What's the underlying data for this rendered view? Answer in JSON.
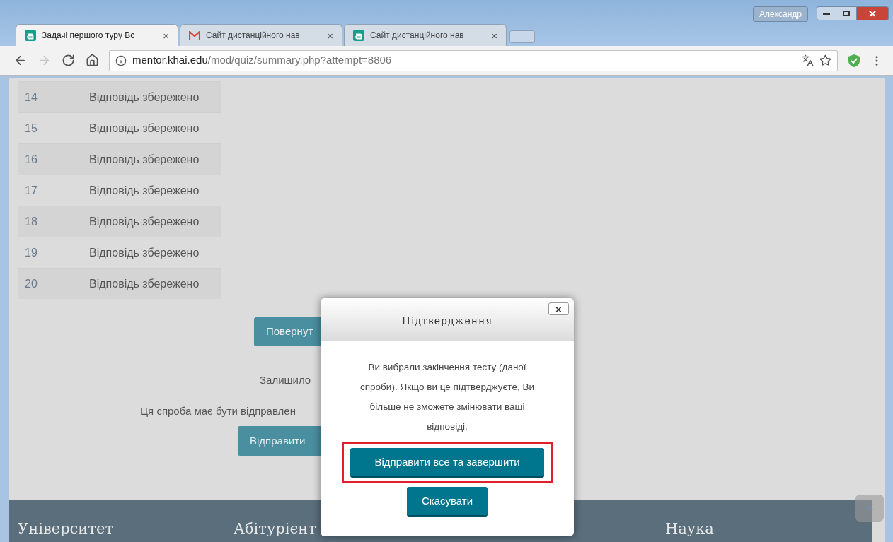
{
  "browser": {
    "profile": "Александр",
    "tabs": [
      {
        "title": "Задачі першого туру Вс",
        "kind": "moodle",
        "selected": true
      },
      {
        "title": "Сайт дистанційного нав",
        "kind": "gmail",
        "selected": false
      },
      {
        "title": "Сайт дистанційного нав",
        "kind": "moodle",
        "selected": false
      }
    ],
    "tab_close": "×",
    "nav_buttons": [
      {
        "kind": "back",
        "disabled": false
      },
      {
        "kind": "forward",
        "disabled": true
      },
      {
        "kind": "reload",
        "disabled": false
      },
      {
        "kind": "home",
        "disabled": false
      }
    ],
    "address": {
      "host": "mentor.khai.edu",
      "path": "/mod/quiz/summary.php?attempt=8806"
    }
  },
  "summary_rows": [
    {
      "number": "14",
      "status": "Відповідь збережено"
    },
    {
      "number": "15",
      "status": "Відповідь збережено"
    },
    {
      "number": "16",
      "status": "Відповідь збережено"
    },
    {
      "number": "17",
      "status": "Відповідь збережено"
    },
    {
      "number": "18",
      "status": "Відповідь збережено"
    },
    {
      "number": "19",
      "status": "Відповідь збережено"
    },
    {
      "number": "20",
      "status": "Відповідь збережено"
    }
  ],
  "return_button": "Повернут",
  "time_left": "Залишило",
  "deadline_note": "Ця спроба має бути відправлен",
  "submit_button": "Відправити",
  "footer": {
    "headings": [
      "Університет",
      "Абітурієнт",
      "Наука"
    ]
  },
  "dialog": {
    "title": "Підтвердження",
    "close": "×",
    "message": "Ви вибрали закінчення тесту (даної спроби). Якщо ви це підтверджуєте, Ви більше не зможете змінювати ваші відповіді.",
    "confirm": "Відправити все та завершити",
    "confirm_highlighted": true,
    "cancel": "Скасувати"
  }
}
